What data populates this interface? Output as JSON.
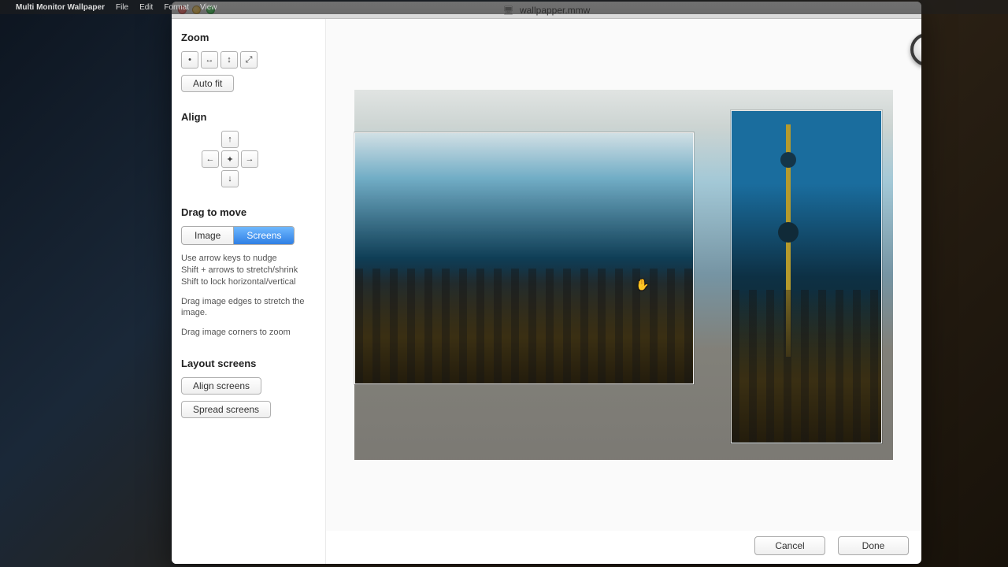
{
  "menubar": {
    "apple": "",
    "app": "Multi Monitor Wallpaper",
    "items": [
      "File",
      "Edit",
      "Format",
      "View"
    ]
  },
  "window": {
    "title": "wallpapper.mmw"
  },
  "sidebar": {
    "zoom": {
      "heading": "Zoom",
      "buttons": {
        "actual": "•",
        "fit_h": "↔",
        "fit_v": "↕",
        "fit_diag": "⤢"
      },
      "auto_fit": "Auto fit"
    },
    "align": {
      "heading": "Align",
      "up": "↑",
      "left": "←",
      "center": "✦",
      "right": "→",
      "down": "↓"
    },
    "drag": {
      "heading": "Drag to move",
      "seg_image": "Image",
      "seg_screens": "Screens",
      "help1": "Use arrow keys to nudge\nShift + arrows to stretch/shrink\nShift to lock horizontal/vertical",
      "help2": "Drag image edges to stretch the image.",
      "help3": "Drag image corners to zoom"
    },
    "layout": {
      "heading": "Layout screens",
      "align_btn": "Align screens",
      "spread_btn": "Spread screens"
    }
  },
  "footer": {
    "cancel": "Cancel",
    "done": "Done"
  }
}
